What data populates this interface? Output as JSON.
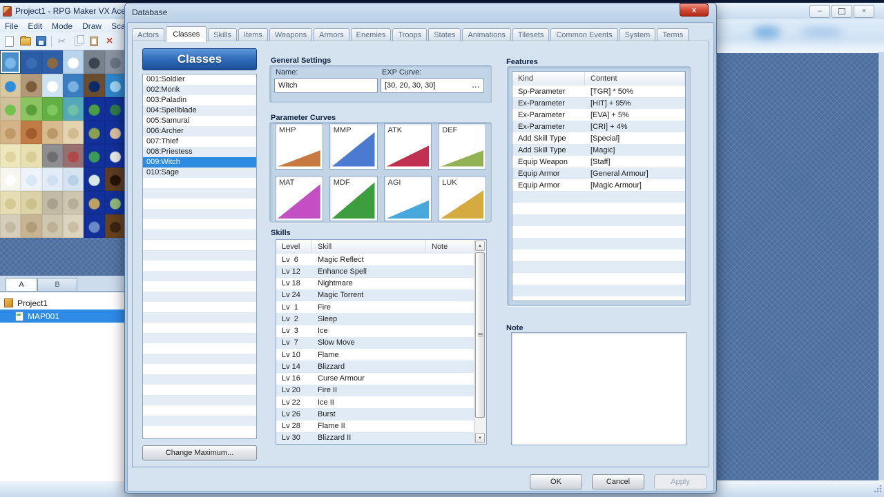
{
  "main_window": {
    "title": "Project1 - RPG Maker VX Ace",
    "menus": [
      "File",
      "Edit",
      "Mode",
      "Draw",
      "Scale"
    ],
    "palette_tabs": {
      "a": "A",
      "b": "B"
    },
    "tree": {
      "root": "Project1",
      "map": "MAP001"
    },
    "icons": {
      "minimize": "–",
      "close": "×",
      "scroll_up": "▲",
      "scroll_down": "▼",
      "cut": "✂"
    }
  },
  "dialog": {
    "title": "Database",
    "close_label": "x",
    "tabs": [
      "Actors",
      "Classes",
      "Skills",
      "Items",
      "Weapons",
      "Armors",
      "Enemies",
      "Troops",
      "States",
      "Animations",
      "Tilesets",
      "Common Events",
      "System",
      "Terms"
    ],
    "active_tab": "Classes",
    "left": {
      "header": "Classes",
      "classes": [
        "001:Soldier",
        "002:Monk",
        "003:Paladin",
        "004:Spellblade",
        "005:Samurai",
        "006:Archer",
        "007:Thief",
        "008:Priestess",
        "009:Witch",
        "010:Sage"
      ],
      "selected": "009:Witch",
      "change_max_label": "Change Maximum..."
    },
    "general": {
      "title": "General Settings",
      "name_label": "Name:",
      "name_value": "Witch",
      "exp_label": "EXP Curve:",
      "exp_value": "[30, 20, 30, 30]",
      "exp_more": "..."
    },
    "curves": {
      "title": "Parameter Curves",
      "items": [
        {
          "label": "MHP",
          "color": "#c87940",
          "peak": 40
        },
        {
          "label": "MMP",
          "color": "#4a7bd0",
          "peak": 85
        },
        {
          "label": "ATK",
          "color": "#c03050",
          "peak": 52
        },
        {
          "label": "DEF",
          "color": "#93b255",
          "peak": 40
        },
        {
          "label": "MAT",
          "color": "#c44fc4",
          "peak": 85
        },
        {
          "label": "MDF",
          "color": "#3d9e3d",
          "peak": 90
        },
        {
          "label": "AGI",
          "color": "#46a8dc",
          "peak": 45
        },
        {
          "label": "LUK",
          "color": "#d4ab3e",
          "peak": 70
        }
      ]
    },
    "skills": {
      "title": "Skills",
      "columns": [
        "Level",
        "Skill",
        "Note"
      ],
      "rows": [
        {
          "level": "Lv  6",
          "skill": "Magic Reflect",
          "note": ""
        },
        {
          "level": "Lv 12",
          "skill": "Enhance Spell",
          "note": ""
        },
        {
          "level": "Lv 18",
          "skill": "Nightmare",
          "note": ""
        },
        {
          "level": "Lv 24",
          "skill": "Magic Torrent",
          "note": ""
        },
        {
          "level": "Lv  1",
          "skill": "Fire",
          "note": ""
        },
        {
          "level": "Lv  2",
          "skill": "Sleep",
          "note": ""
        },
        {
          "level": "Lv  3",
          "skill": "Ice",
          "note": ""
        },
        {
          "level": "Lv  7",
          "skill": "Slow Move",
          "note": ""
        },
        {
          "level": "Lv 10",
          "skill": "Flame",
          "note": ""
        },
        {
          "level": "Lv 14",
          "skill": "Blizzard",
          "note": ""
        },
        {
          "level": "Lv 16",
          "skill": "Curse Armour",
          "note": ""
        },
        {
          "level": "Lv 20",
          "skill": "Fire II",
          "note": ""
        },
        {
          "level": "Lv 22",
          "skill": "Ice II",
          "note": ""
        },
        {
          "level": "Lv 26",
          "skill": "Burst",
          "note": ""
        },
        {
          "level": "Lv 28",
          "skill": "Flame II",
          "note": ""
        },
        {
          "level": "Lv 30",
          "skill": "Blizzard II",
          "note": ""
        }
      ]
    },
    "features": {
      "title": "Features",
      "columns": [
        "Kind",
        "Content"
      ],
      "rows": [
        {
          "kind": "Sp-Parameter",
          "content": "[TGR] * 50%"
        },
        {
          "kind": "Ex-Parameter",
          "content": "[HIT] + 95%"
        },
        {
          "kind": "Ex-Parameter",
          "content": "[EVA] + 5%"
        },
        {
          "kind": "Ex-Parameter",
          "content": "[CRI] + 4%"
        },
        {
          "kind": "Add Skill Type",
          "content": "[Special]"
        },
        {
          "kind": "Add Skill Type",
          "content": "[Magic]"
        },
        {
          "kind": "Equip Weapon",
          "content": "[Staff]"
        },
        {
          "kind": "Equip Armor",
          "content": "[General Armour]"
        },
        {
          "kind": "Equip Armor",
          "content": "[Magic Armour]"
        }
      ]
    },
    "note": {
      "title": "Note",
      "value": ""
    },
    "buttons": {
      "ok": "OK",
      "cancel": "Cancel",
      "apply": "Apply",
      "apply_enabled": false
    }
  },
  "colors": {
    "selection": "#2e8ce0",
    "classes_banner_top": "#5e97dc",
    "classes_banner_bottom": "#1c4f9a",
    "dialog_close_red": "#c23a24",
    "map_background": "#4d70a0"
  },
  "palette": {
    "tiles": [
      {
        "c": "#4a90cc",
        "d": "#7ab8e8",
        "sel": true
      },
      {
        "c": "#2b5ca6",
        "d": "#3a6cb4"
      },
      {
        "c": "#2e5fa8",
        "d": "#8a6a42"
      },
      {
        "c": "#b8d4ec",
        "d": "#ffffff"
      },
      {
        "c": "#78828f",
        "d": "#3a4450"
      },
      {
        "c": "#8a93a2",
        "d": "#6a7482"
      },
      {
        "c": "#d8c8a0",
        "d": "#2e8cd8"
      },
      {
        "c": "#b09878",
        "d": "#7a5c3a"
      },
      {
        "c": "#cce2f2",
        "d": "#ffffff"
      },
      {
        "c": "#3a7cc0",
        "d": "#78b0e0"
      },
      {
        "c": "#6a4c30",
        "d": "#0a2a6a"
      },
      {
        "c": "#2f84c6",
        "d": "#9ad0f0"
      },
      {
        "c": "#cfc09a",
        "d": "#74c24e"
      },
      {
        "c": "#8cc460",
        "d": "#5a9e3a"
      },
      {
        "c": "#62b044",
        "d": "#7ec85c"
      },
      {
        "c": "#55a8b8",
        "d": "#70c0a8"
      },
      {
        "c": "#12309a",
        "d": "#4aa040"
      },
      {
        "c": "#12309a",
        "d": "#2e7a4a"
      },
      {
        "c": "#d4b488",
        "d": "#c09868"
      },
      {
        "c": "#c07c44",
        "d": "#a05c2c"
      },
      {
        "c": "#d8bc90",
        "d": "#b89868"
      },
      {
        "c": "#e4d4b0",
        "d": "#d0bc90"
      },
      {
        "c": "#12309a",
        "d": "#8aa050"
      },
      {
        "c": "#12309a",
        "d": "#d8c0a0"
      },
      {
        "c": "#eee6bc",
        "d": "#e0d4a0"
      },
      {
        "c": "#e8e0b0",
        "d": "#d8cc98"
      },
      {
        "c": "#8e8e90",
        "d": "#6e6e70"
      },
      {
        "c": "#96706e",
        "d": "#b04848"
      },
      {
        "c": "#12309a",
        "d": "#3a9a5a"
      },
      {
        "c": "#12309a",
        "d": "#e8e8e8"
      },
      {
        "c": "#f6f6ee",
        "d": "#ffffff"
      },
      {
        "c": "#eef4fa",
        "d": "#d8e8f4"
      },
      {
        "c": "#e2ecf6",
        "d": "#cfe0f0"
      },
      {
        "c": "#d6e4f2",
        "d": "#b8d0e8"
      },
      {
        "c": "#12309a",
        "d": "#d8e8e8"
      },
      {
        "c": "#5e3c20",
        "d": "#241408"
      },
      {
        "c": "#e6ddb4",
        "d": "#d6c894"
      },
      {
        "c": "#dcd2a8",
        "d": "#ccc08c"
      },
      {
        "c": "#c2baa4",
        "d": "#a8a08c"
      },
      {
        "c": "#cec6b0",
        "d": "#b6ae98"
      },
      {
        "c": "#12309a",
        "d": "#c0a060"
      },
      {
        "c": "#12309a",
        "d": "#90b878"
      },
      {
        "c": "#d6cdbb",
        "d": "#c4baa4"
      },
      {
        "c": "#c6b493",
        "d": "#b09c78"
      },
      {
        "c": "#cfc6ae",
        "d": "#bcb096"
      },
      {
        "c": "#dcd4be",
        "d": "#cabfa4"
      },
      {
        "c": "#12309a",
        "d": "#6888c8"
      },
      {
        "c": "#66421f",
        "d": "#3a240e"
      }
    ]
  }
}
